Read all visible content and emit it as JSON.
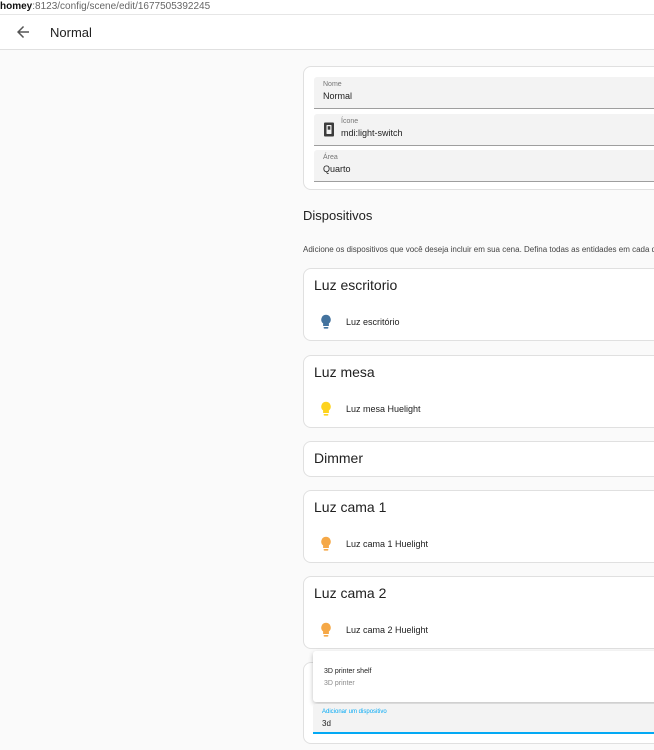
{
  "browser": {
    "url_host": "homey",
    "url_rest": ":8123/config/scene/edit/1677505392245"
  },
  "header": {
    "back_icon": "arrow-left-icon",
    "title": "Normal"
  },
  "form": {
    "name": {
      "label": "Nome",
      "value": "Normal"
    },
    "icon": {
      "label": "Ícone",
      "value": "mdi:light-switch",
      "icon": "light-switch-icon"
    },
    "area": {
      "label": "Área",
      "value": "Quarto"
    }
  },
  "devices_section": {
    "title": "Dispositivos",
    "description": "Adicione os dispositivos que você deseja incluir em sua cena. Defina todas as entidades em cada d"
  },
  "devices": [
    {
      "name": "Luz escritorio",
      "entities": [
        {
          "name": "Luz escritório",
          "icon": "lightbulb-icon",
          "color": "#44739e"
        }
      ]
    },
    {
      "name": "Luz mesa",
      "entities": [
        {
          "name": "Luz mesa Huelight",
          "icon": "lightbulb-icon",
          "color": "#fdd31f"
        }
      ]
    },
    {
      "name": "Dimmer",
      "entities": []
    },
    {
      "name": "Luz cama 1",
      "entities": [
        {
          "name": "Luz cama 1 Huelight",
          "icon": "lightbulb-icon",
          "color": "#f5a847"
        }
      ]
    },
    {
      "name": "Luz cama 2",
      "entities": [
        {
          "name": "Luz cama 2 Huelight",
          "icon": "lightbulb-icon",
          "color": "#f5a847"
        }
      ]
    }
  ],
  "add_device": {
    "label": "Adicionar um dispositivo",
    "value": "3d",
    "suggestion": {
      "name": "3D printer shelf",
      "subtitle": "3D printer"
    }
  },
  "colors": {
    "accent": "#03a9f4",
    "card_border": "#e0e0e0",
    "field_bg": "#f3f3f3"
  }
}
